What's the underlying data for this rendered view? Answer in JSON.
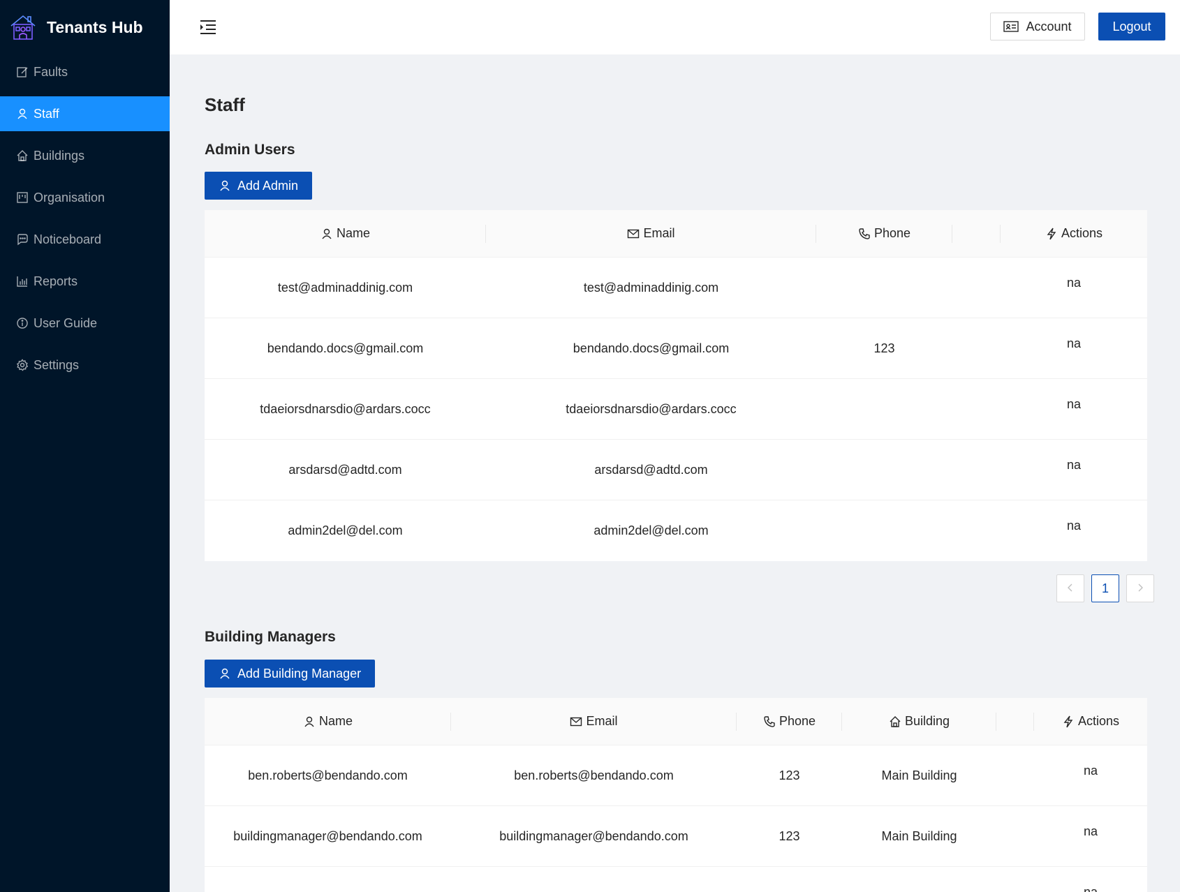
{
  "app": {
    "title": "Tenants Hub"
  },
  "sidebar": {
    "items": [
      {
        "label": "Faults",
        "icon": "edit-icon",
        "active": false
      },
      {
        "label": "Staff",
        "icon": "user-icon",
        "active": true
      },
      {
        "label": "Buildings",
        "icon": "home-icon",
        "active": false
      },
      {
        "label": "Organisation",
        "icon": "project-icon",
        "active": false
      },
      {
        "label": "Noticeboard",
        "icon": "message-icon",
        "active": false
      },
      {
        "label": "Reports",
        "icon": "bar-chart-icon",
        "active": false
      },
      {
        "label": "User Guide",
        "icon": "info-circle-icon",
        "active": false
      },
      {
        "label": "Settings",
        "icon": "gear-icon",
        "active": false
      }
    ]
  },
  "header": {
    "account_label": "Account",
    "logout_label": "Logout"
  },
  "page": {
    "title": "Staff"
  },
  "admins": {
    "title": "Admin Users",
    "add_label": "Add Admin",
    "columns": {
      "name": "Name",
      "email": "Email",
      "phone": "Phone",
      "actions": "Actions"
    },
    "rows": [
      {
        "name": "test@adminaddinig.com",
        "email": "test@adminaddinig.com",
        "phone": "",
        "actions": "na"
      },
      {
        "name": "bendando.docs@gmail.com",
        "email": "bendando.docs@gmail.com",
        "phone": "123",
        "actions": "na"
      },
      {
        "name": "tdaeiorsdnarsdio@ardars.cocc",
        "email": "tdaeiorsdnarsdio@ardars.cocc",
        "phone": "",
        "actions": "na"
      },
      {
        "name": "arsdarsd@adtd.com",
        "email": "arsdarsd@adtd.com",
        "phone": "",
        "actions": "na"
      },
      {
        "name": "admin2del@del.com",
        "email": "admin2del@del.com",
        "phone": "",
        "actions": "na"
      }
    ],
    "pagination": {
      "current_page": "1"
    }
  },
  "managers": {
    "title": "Building Managers",
    "add_label": "Add Building Manager",
    "columns": {
      "name": "Name",
      "email": "Email",
      "phone": "Phone",
      "building": "Building",
      "actions": "Actions"
    },
    "rows": [
      {
        "name": "ben.roberts@bendando.com",
        "email": "ben.roberts@bendando.com",
        "phone": "123",
        "building": "Main Building",
        "actions": "na"
      },
      {
        "name": "buildingmanager@bendando.com",
        "email": "buildingmanager@bendando.com",
        "phone": "123",
        "building": "Main Building",
        "actions": "na"
      },
      {
        "name": "",
        "email": "",
        "phone": "",
        "building": "",
        "actions": "na"
      }
    ]
  },
  "colors": {
    "sidebar_bg": "#001529",
    "active_item": "#1890ff",
    "primary": "#0b4fb3",
    "page_bg": "#f0f2f5"
  }
}
